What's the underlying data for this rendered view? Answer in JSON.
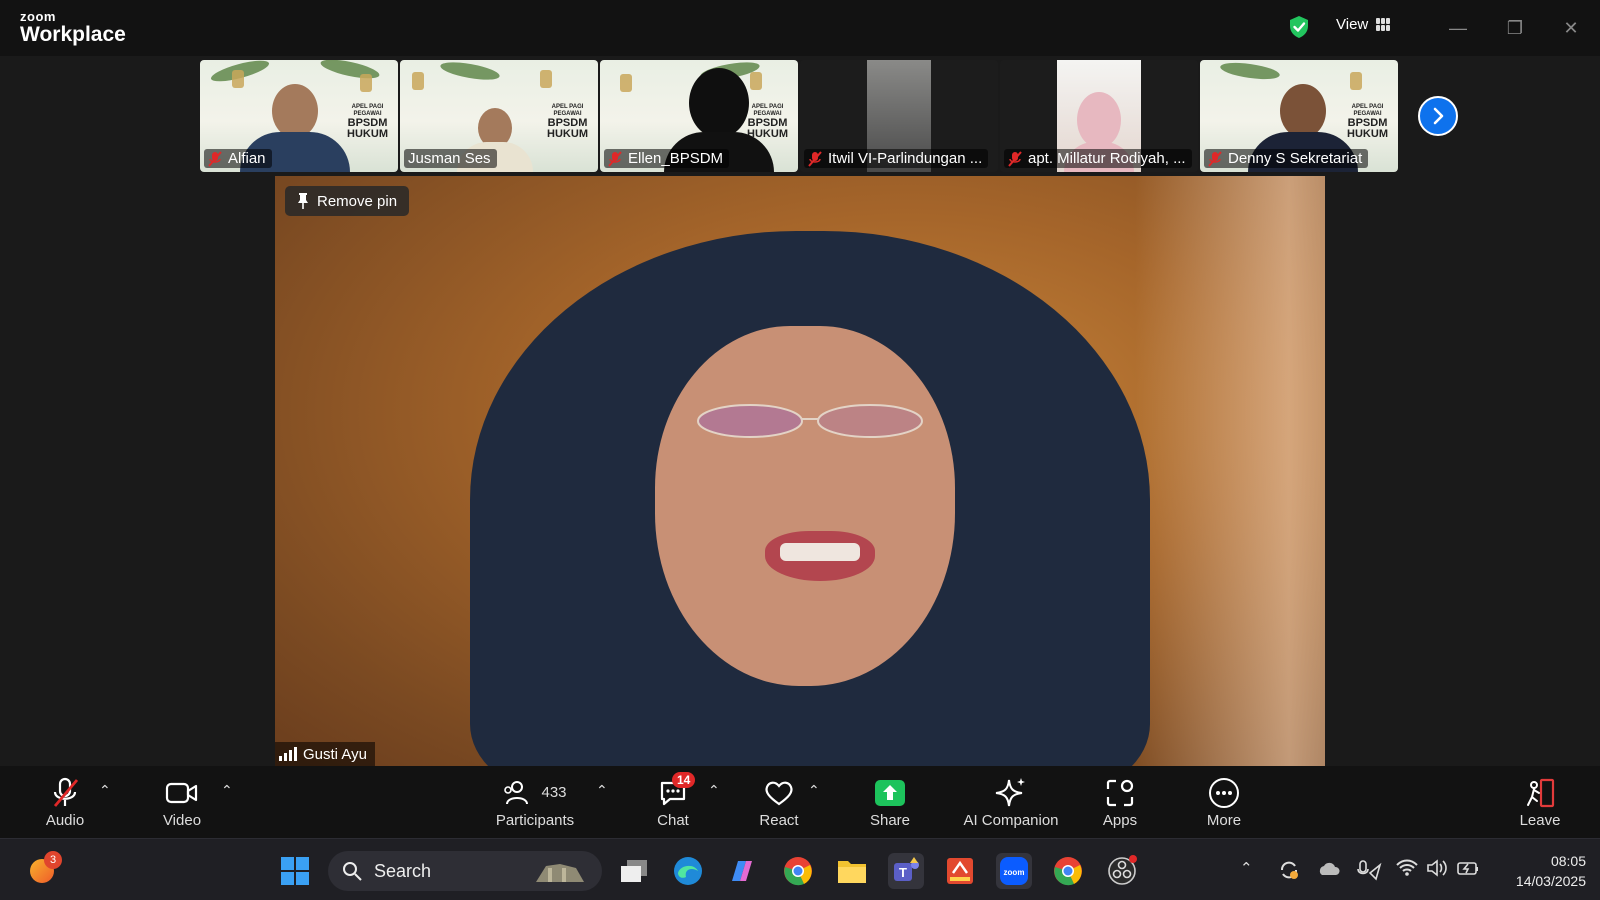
{
  "app": {
    "brand_top": "zoom",
    "brand_bottom": "Workplace",
    "view_label": "View"
  },
  "participants_strip": [
    {
      "name": "Alfian",
      "type": "banner"
    },
    {
      "name": "Jusman Ses",
      "type": "banner"
    },
    {
      "name": "Ellen_BPSDM",
      "type": "banner"
    },
    {
      "name": "Itwil VI-Parlindungan ...",
      "type": "dark"
    },
    {
      "name": "apt. Millatur Rodiyah, ...",
      "type": "dark"
    },
    {
      "name": "Denny S Sekretariat",
      "type": "banner"
    }
  ],
  "banner": {
    "line1": "APEL PAGI",
    "line2": "PEGAWAI",
    "line3": "BPSDM",
    "line4": "HUKUM",
    "org": "bpsdm"
  },
  "main_video": {
    "remove_pin_label": "Remove pin",
    "speaker_name": "Gusti Ayu"
  },
  "toolbar": {
    "audio": "Audio",
    "video": "Video",
    "participants": "Participants",
    "participants_count": "433",
    "chat": "Chat",
    "chat_badge": "14",
    "react": "React",
    "share": "Share",
    "ai_companion": "AI Companion",
    "apps": "Apps",
    "more": "More",
    "leave": "Leave"
  },
  "taskbar": {
    "notification_count": "3",
    "search_placeholder": "Search",
    "time": "08:05",
    "date": "14/03/2025"
  },
  "colors": {
    "accent": "#0e72ed",
    "share_green": "#1dc35c",
    "danger": "#e02828",
    "shield": "#22c55e"
  }
}
